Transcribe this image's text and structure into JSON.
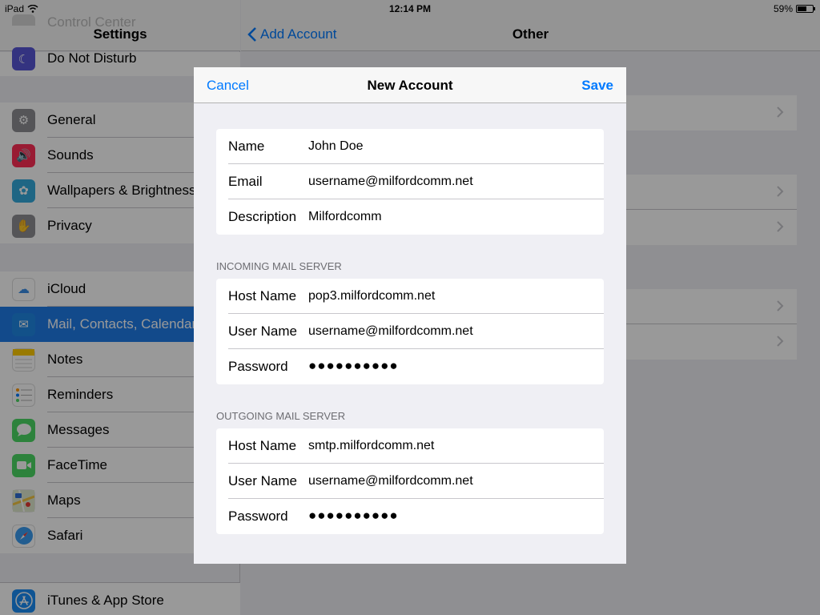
{
  "status_bar": {
    "device": "iPad",
    "time": "12:14 PM",
    "battery": "59%",
    "battery_level": 0.59
  },
  "settings": {
    "title": "Settings",
    "ghost_item": "Control Center",
    "group1": [
      {
        "label": "Do Not Disturb",
        "icon": "moon-icon",
        "color": "#5856d6"
      }
    ],
    "group2": [
      {
        "label": "General",
        "icon": "gear-icon",
        "color": "#8e8e93"
      },
      {
        "label": "Sounds",
        "icon": "speaker-icon",
        "color": "#ff2d55"
      },
      {
        "label": "Wallpapers & Brightness",
        "icon": "flower-icon",
        "color": "#34aadc"
      },
      {
        "label": "Privacy",
        "icon": "hand-icon",
        "color": "#8e8e93"
      }
    ],
    "group3": [
      {
        "label": "iCloud",
        "icon": "cloud-icon",
        "color": "#ffffff"
      },
      {
        "label": "Mail, Contacts, Calendars",
        "icon": "envelope-icon",
        "color": "#1e88e5",
        "selected": true
      },
      {
        "label": "Notes",
        "icon": "notes-icon",
        "color": "#ffcc00"
      },
      {
        "label": "Reminders",
        "icon": "list-icon",
        "color": "#ffffff"
      },
      {
        "label": "Messages",
        "icon": "speech-bubble-icon",
        "color": "#4cd964"
      },
      {
        "label": "FaceTime",
        "icon": "video-camera-icon",
        "color": "#4cd964"
      },
      {
        "label": "Maps",
        "icon": "map-icon",
        "color": "#e8e8e8"
      },
      {
        "label": "Safari",
        "icon": "compass-icon",
        "color": "#ffffff"
      }
    ],
    "group4": [
      {
        "label": "iTunes & App Store",
        "icon": "app-store-icon",
        "color": "#1a8df5"
      }
    ]
  },
  "detail": {
    "back_label": "Add Account",
    "title": "Other"
  },
  "modal": {
    "cancel": "Cancel",
    "title": "New Account",
    "save": "Save",
    "account": {
      "name_label": "Name",
      "name_value": "John Doe",
      "email_label": "Email",
      "email_value": "username@milfordcomm.net",
      "description_label": "Description",
      "description_value": "Milfordcomm"
    },
    "incoming": {
      "header": "INCOMING MAIL SERVER",
      "host_label": "Host Name",
      "host_value": "pop3.milfordcomm.net",
      "user_label": "User Name",
      "user_value": "username@milfordcomm.net",
      "password_label": "Password",
      "password_value": "●●●●●●●●●●"
    },
    "outgoing": {
      "header": "OUTGOING MAIL SERVER",
      "host_label": "Host Name",
      "host_value": "smtp.milfordcomm.net",
      "user_label": "User Name",
      "user_value": "username@milfordcomm.net",
      "password_label": "Password",
      "password_value": "●●●●●●●●●●"
    }
  }
}
